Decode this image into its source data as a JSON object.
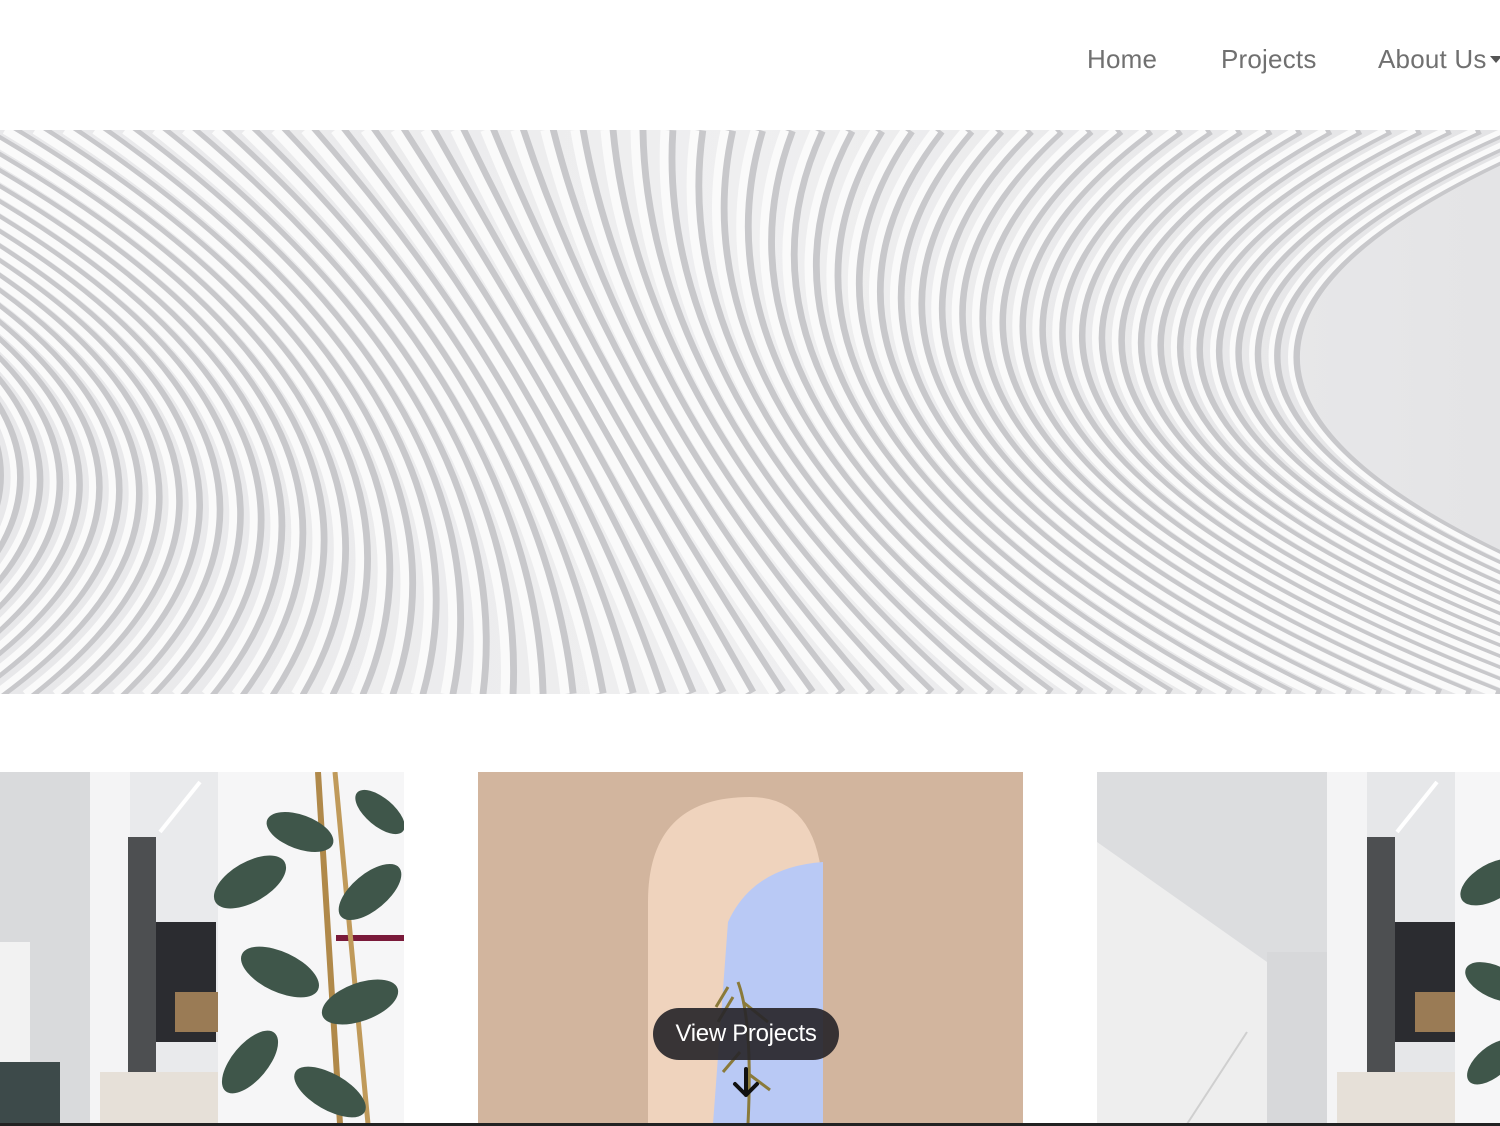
{
  "nav": {
    "items": [
      {
        "label": "Home"
      },
      {
        "label": "Projects"
      },
      {
        "label": "About Us"
      }
    ]
  },
  "hero": {
    "image": "white architectural ribbed ceiling"
  },
  "gallery": {
    "tiles": [
      {
        "image": "white hallway with rubber plant"
      },
      {
        "image": "peach arched window with palm tree"
      },
      {
        "image": "white staircase hallway with plant"
      }
    ],
    "cta_label": "View Projects",
    "cta_icon": "arrow-down-icon"
  },
  "colors": {
    "nav_text": "#707070",
    "cta_bg": "#28262a",
    "arch_wall": "#d2b59e",
    "sky": "#b9c9f5"
  }
}
